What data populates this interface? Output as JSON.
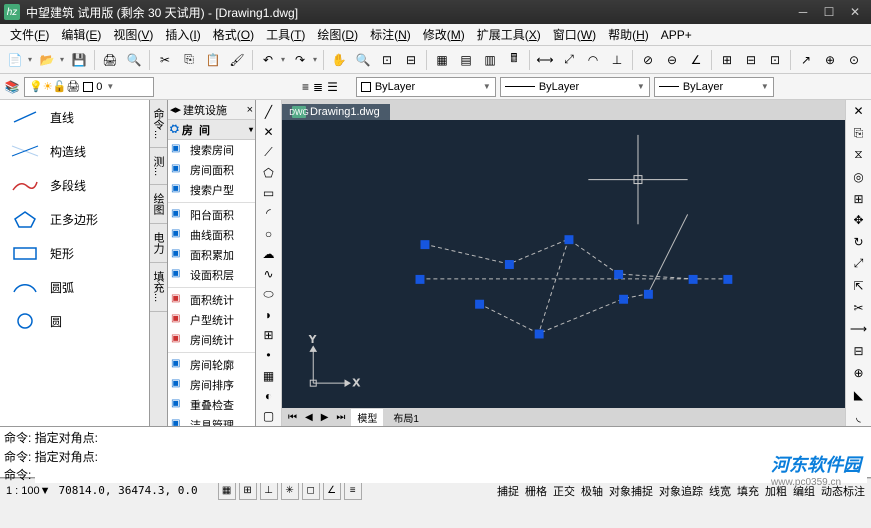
{
  "title": "中望建筑 试用版 (剩余 30 天试用)  - [Drawing1.dwg]",
  "menus": [
    {
      "label": "文件",
      "key": "F"
    },
    {
      "label": "编辑",
      "key": "E"
    },
    {
      "label": "视图",
      "key": "V"
    },
    {
      "label": "插入",
      "key": "I"
    },
    {
      "label": "格式",
      "key": "O"
    },
    {
      "label": "工具",
      "key": "T"
    },
    {
      "label": "绘图",
      "key": "D"
    },
    {
      "label": "标注",
      "key": "N"
    },
    {
      "label": "修改",
      "key": "M"
    },
    {
      "label": "扩展工具",
      "key": "X"
    },
    {
      "label": "窗口",
      "key": "W"
    },
    {
      "label": "帮助",
      "key": "H"
    },
    {
      "label": "APP+",
      "key": ""
    }
  ],
  "layer": {
    "value": "0"
  },
  "prop": {
    "color_label": "ByLayer",
    "linetype": "ByLayer",
    "lineweight": "ByLayer"
  },
  "left_tools": [
    {
      "name": "line",
      "label": "直线"
    },
    {
      "name": "xline",
      "label": "构造线"
    },
    {
      "name": "polyline",
      "label": "多段线"
    },
    {
      "name": "polygon",
      "label": "正多边形"
    },
    {
      "name": "rectangle",
      "label": "矩形"
    },
    {
      "name": "arc",
      "label": "圆弧"
    },
    {
      "name": "circle",
      "label": "圆"
    }
  ],
  "vtabs": [
    "命令...",
    "测...",
    "绘图",
    "电力",
    "填充..."
  ],
  "mid": {
    "header": "建筑设施",
    "cat_prefix": "房",
    "cat_suffix": "间",
    "items": [
      {
        "t": "搜索房间"
      },
      {
        "t": "房间面积"
      },
      {
        "t": "搜索户型"
      },
      {
        "sep": true
      },
      {
        "t": "阳台面积"
      },
      {
        "t": "曲线面积"
      },
      {
        "t": "面积累加"
      },
      {
        "t": "设面积层"
      },
      {
        "sep": true
      },
      {
        "t": "面积统计",
        "c": "#c33"
      },
      {
        "t": "户型统计",
        "c": "#c33"
      },
      {
        "t": "房间统计",
        "c": "#c33"
      },
      {
        "sep": true
      },
      {
        "t": "房间轮廓"
      },
      {
        "t": "房间排序"
      },
      {
        "t": "重叠检查"
      },
      {
        "t": "洁具管理"
      }
    ]
  },
  "doc_tab": "Drawing1.dwg",
  "layout_tabs": {
    "model": "模型",
    "layout1": "布局1"
  },
  "cmd": {
    "line1": "命令: 指定对角点:",
    "line2": "命令: 指定对角点:",
    "prompt": "命令:"
  },
  "status": {
    "scale": "1 : 100▼",
    "coords": "70814.0,   36474.3, 0.0",
    "labels": [
      "捕捉",
      "栅格",
      "正交",
      "极轴",
      "对象捕捉",
      "对象追踪",
      "线宽",
      "填充",
      "加粗",
      "编组",
      "动态标注"
    ]
  },
  "watermark": {
    "main": "河东软件园",
    "sub": "www.pc0359.cn"
  }
}
